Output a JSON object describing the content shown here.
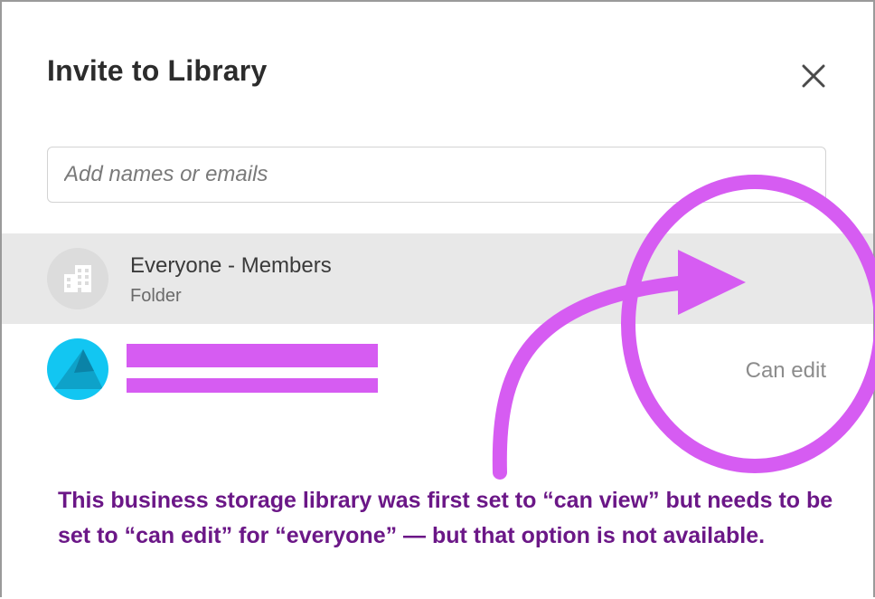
{
  "dialog": {
    "title": "Invite to Library",
    "close_icon": "close-icon"
  },
  "search": {
    "placeholder": "Add names or emails",
    "value": ""
  },
  "members": [
    {
      "name": "Everyone - Members",
      "subtitle": "Folder",
      "icon": "building-icon",
      "highlighted": true
    },
    {
      "name": "",
      "email": "",
      "redacted": true,
      "permission": "Can edit"
    }
  ],
  "annotation": {
    "caption": "This business storage library was first set to “can view” but needs to be set to “can edit” for “everyone” — but that option is not available.",
    "color": "#d65cf2",
    "text_color": "#6b1787"
  },
  "colors": {
    "highlight_row": "#e8e8e8",
    "user_avatar": "#12c6f2"
  }
}
